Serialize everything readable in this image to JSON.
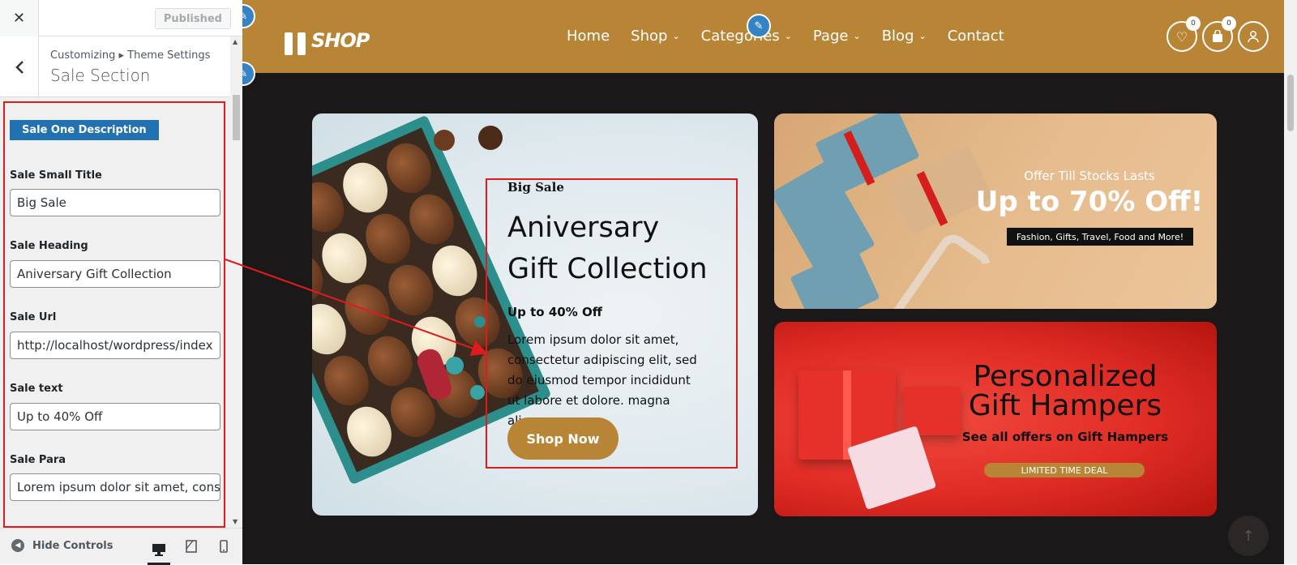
{
  "customizer": {
    "close_icon": "✕",
    "publish_label": "Published",
    "breadcrumb": "Customizing ▸ Theme Settings",
    "section_title": "Sale Section",
    "back_icon": "‹",
    "description_badge": "Sale One Description",
    "fields": {
      "small_title": {
        "label": "Sale Small Title",
        "value": "Big Sale"
      },
      "heading": {
        "label": "Sale Heading",
        "value": "Aniversary Gift Collection"
      },
      "url": {
        "label": "Sale Url",
        "value": "http://localhost/wordpress/index"
      },
      "text": {
        "label": "Sale text",
        "value": "Up to 40% Off"
      },
      "para": {
        "label": "Sale Para",
        "value": "Lorem ipsum dolor sit amet, conse"
      }
    },
    "footer": {
      "hide_controls": "Hide Controls"
    }
  },
  "site": {
    "logo_text": "SHOP",
    "nav": [
      {
        "label": "Home",
        "has_dropdown": false
      },
      {
        "label": "Shop",
        "has_dropdown": true
      },
      {
        "label": "Categories",
        "has_dropdown": true
      },
      {
        "label": "Page",
        "has_dropdown": true
      },
      {
        "label": "Blog",
        "has_dropdown": true
      },
      {
        "label": "Contact",
        "has_dropdown": false
      }
    ],
    "wishlist_count": "0",
    "cart_count": "0",
    "brand_color": "#b88537",
    "edit_icon": "pencil-icon"
  },
  "banner_main": {
    "small_title": "Big Sale",
    "heading": "Aniversary Gift Collection",
    "text": "Up to 40% Off",
    "para": "Lorem ipsum dolor sit amet, consectetur adipiscing elit, sed do eiusmod tempor incididunt ut labore et dolore. magna aliqua.",
    "button": "Shop Now"
  },
  "banner_offer": {
    "small": "Offer Till Stocks Lasts",
    "big": "Up to 70% Off!",
    "tag": "Fashion, Gifts, Travel, Food and More!"
  },
  "banner_hampers": {
    "title": "Personalized Gift Hampers",
    "subtitle": "See all offers on Gift Hampers",
    "deal": "LIMITED TIME DEAL"
  },
  "to_top_icon": "↑"
}
